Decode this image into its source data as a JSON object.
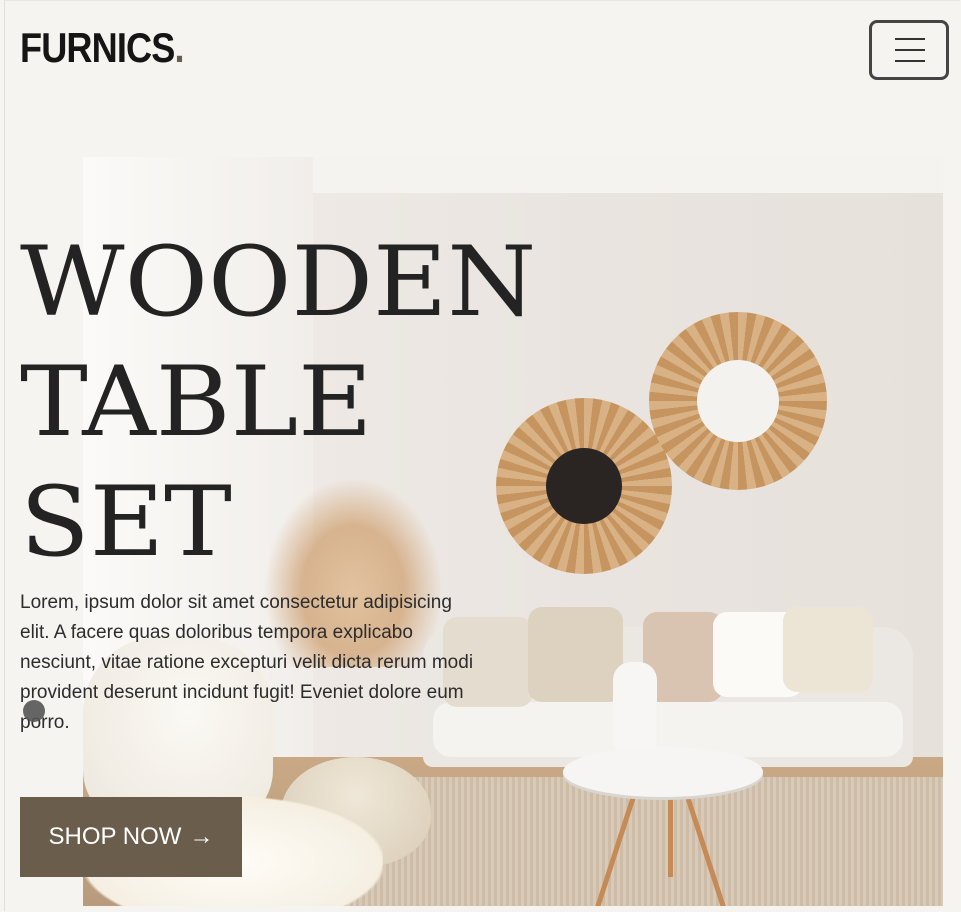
{
  "header": {
    "logo_text": "FURNICS",
    "logo_dot": ".",
    "menu_icon": "hamburger-icon"
  },
  "hero": {
    "title_lines": [
      "WOODEN",
      "TABLE",
      "SET"
    ],
    "description": "Lorem, ipsum dolor sit amet consectetur adipisicing elit. A facere quas doloribus tempora explicabo nesciunt, vitae ratione excepturi velit dicta rerum modi provident deserunt incidunt fugit! Eveniet dolore eum porro.",
    "cta_label": "SHOP NOW",
    "cta_icon": "arrow-right-icon",
    "image": "living-room-photo"
  },
  "colors": {
    "background": "#f5f4f1",
    "accent": "#6a5d4b",
    "text": "#232323"
  }
}
